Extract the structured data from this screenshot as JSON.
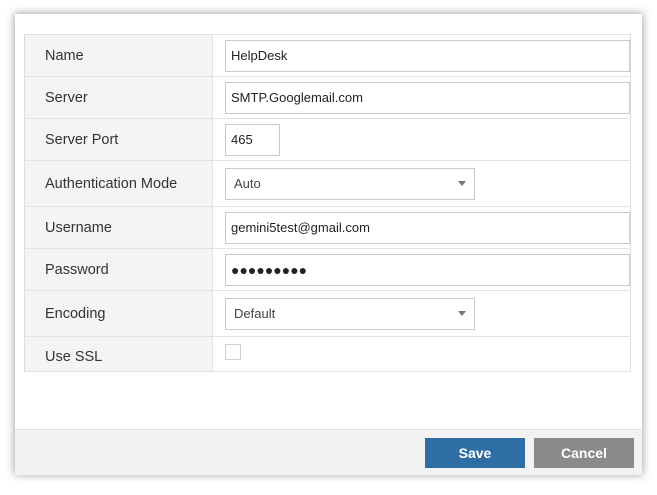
{
  "form": {
    "name": {
      "label": "Name",
      "value": "HelpDesk"
    },
    "server": {
      "label": "Server",
      "value": "SMTP.Googlemail.com"
    },
    "server_port": {
      "label": "Server Port",
      "value": "465"
    },
    "auth_mode": {
      "label": "Authentication Mode",
      "selected": "Auto"
    },
    "username": {
      "label": "Username",
      "value": "gemini5test@gmail.com"
    },
    "password": {
      "label": "Password",
      "masked_value": "●●●●●●●●●"
    },
    "encoding": {
      "label": "Encoding",
      "selected": "Default"
    },
    "use_ssl": {
      "label": "Use SSL",
      "checked": false
    }
  },
  "footer": {
    "save_label": "Save",
    "cancel_label": "Cancel"
  },
  "colors": {
    "save_button": "#2f6ea5",
    "cancel_button": "#8a8a8a",
    "label_cell_bg": "#f4f4f4"
  }
}
